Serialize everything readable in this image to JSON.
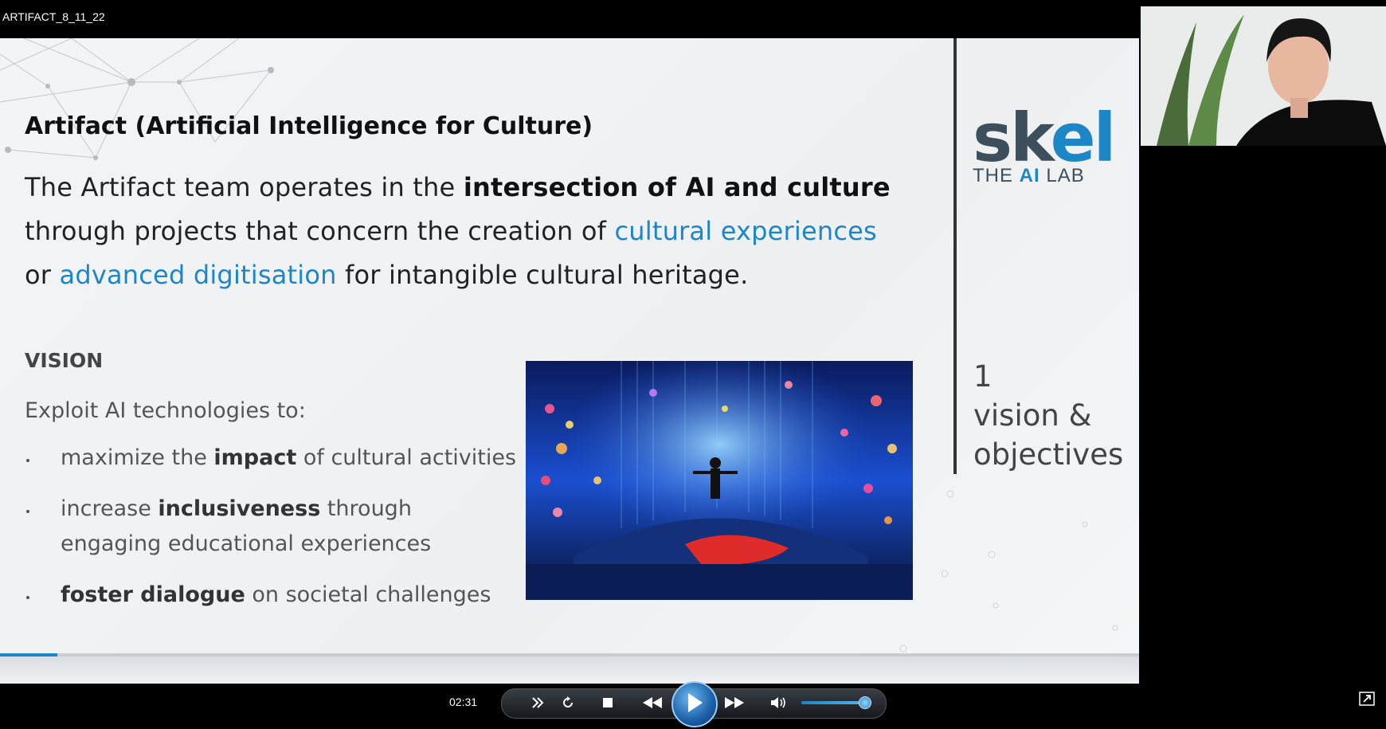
{
  "window": {
    "title": "ARTIFACT_8_11_22"
  },
  "slide": {
    "title": "Artifact (Artificial Intelligence for Culture)",
    "intro": {
      "p1": "The Artifact team operates in the ",
      "b1": "intersection of AI and culture",
      "p2": " through projects that concern the creation of ",
      "blue1": "cultural experiences",
      "p3": " or ",
      "blue2": "advanced digitisation",
      "p4": " for intangible cultural heritage."
    },
    "vision_heading": "VISION",
    "exploit": "Exploit AI technologies to:",
    "bullets": [
      {
        "pre": "maximize the ",
        "bold": "impact",
        "post": " of cultural activities"
      },
      {
        "pre": "increase ",
        "bold": "inclusiveness",
        "post": " through engaging educational experiences"
      },
      {
        "pre": "",
        "bold": "foster dialogue",
        "post": " on societal challenges"
      }
    ],
    "logo": {
      "main_a": "sk",
      "main_b": "el",
      "sub_a": "THE ",
      "sub_ai": "AI",
      "sub_b": " LAB"
    },
    "section": {
      "number": "1",
      "line1": "vision &",
      "line2": "objectives"
    }
  },
  "player": {
    "time": "02:31",
    "progress_fraction": 0.05,
    "volume_fraction": 0.85,
    "icons": [
      "switch-icon",
      "repeat-icon",
      "stop-icon",
      "rewind-icon",
      "play-icon",
      "fast-forward-icon",
      "volume-icon",
      "popout-icon",
      "expand-icon"
    ]
  },
  "colors": {
    "accent": "#1d86c6",
    "logo_gray": "#3d4f5c"
  }
}
